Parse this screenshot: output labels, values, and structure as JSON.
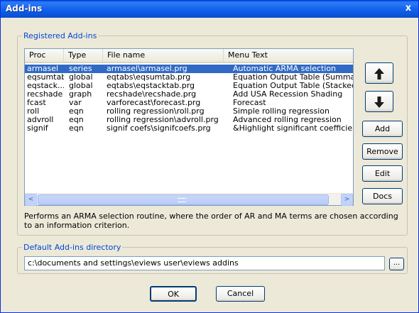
{
  "window": {
    "title": "Add-ins",
    "close_glyph": "x"
  },
  "registered": {
    "legend": "Registered Add-ins",
    "columns": [
      "Proc",
      "Type",
      "File name",
      "Menu Text"
    ],
    "rows": [
      {
        "proc": "armasel",
        "type": "series",
        "file": "armasel\\armasel.prg",
        "menu": "Automatic ARMA selection",
        "selected": true
      },
      {
        "proc": "eqsumtab",
        "type": "global",
        "file": "eqtabs\\eqsumtab.prg",
        "menu": "Equation Output Table (Summary fo",
        "selected": false
      },
      {
        "proc": "eqstack...",
        "type": "global",
        "file": "eqtabs\\eqstacktab.prg",
        "menu": "Equation Output Table (Stacked for",
        "selected": false
      },
      {
        "proc": "recshade",
        "type": "graph",
        "file": "recshade\\recshade.prg",
        "menu": "Add USA Recession Shading",
        "selected": false
      },
      {
        "proc": "fcast",
        "type": "var",
        "file": "varforecast\\forecast.prg",
        "menu": "Forecast",
        "selected": false
      },
      {
        "proc": "roll",
        "type": "eqn",
        "file": "rolling regression\\roll.prg",
        "menu": "Simple rolling regression",
        "selected": false
      },
      {
        "proc": "advroll",
        "type": "eqn",
        "file": "rolling regression\\advroll.prg",
        "menu": "Advanced rolling regression",
        "selected": false
      },
      {
        "proc": "signif",
        "type": "eqn",
        "file": "signif coefs\\signifcoefs.prg",
        "menu": "&Highlight significant coefficients",
        "selected": false
      }
    ],
    "scroll_left_glyph": "<",
    "scroll_right_glyph": ">",
    "description": "Performs an ARMA selection routine, where the order of AR and MA terms are chosen according to an information criterion."
  },
  "side_buttons": {
    "up_icon": "up-arrow-icon",
    "down_icon": "down-arrow-icon",
    "add": "Add",
    "remove": "Remove",
    "edit": "Edit",
    "docs": "Docs"
  },
  "directory": {
    "legend": "Default Add-ins directory",
    "value": "c:\\documents and settings\\eviews user\\eviews addins",
    "browse_label": "..."
  },
  "footer": {
    "ok": "OK",
    "cancel": "Cancel"
  },
  "colors": {
    "titlebar": "#0a5ee8",
    "selection": "#316ac5",
    "group_legend": "#0046d5",
    "dialog_bg": "#ece9d8"
  }
}
